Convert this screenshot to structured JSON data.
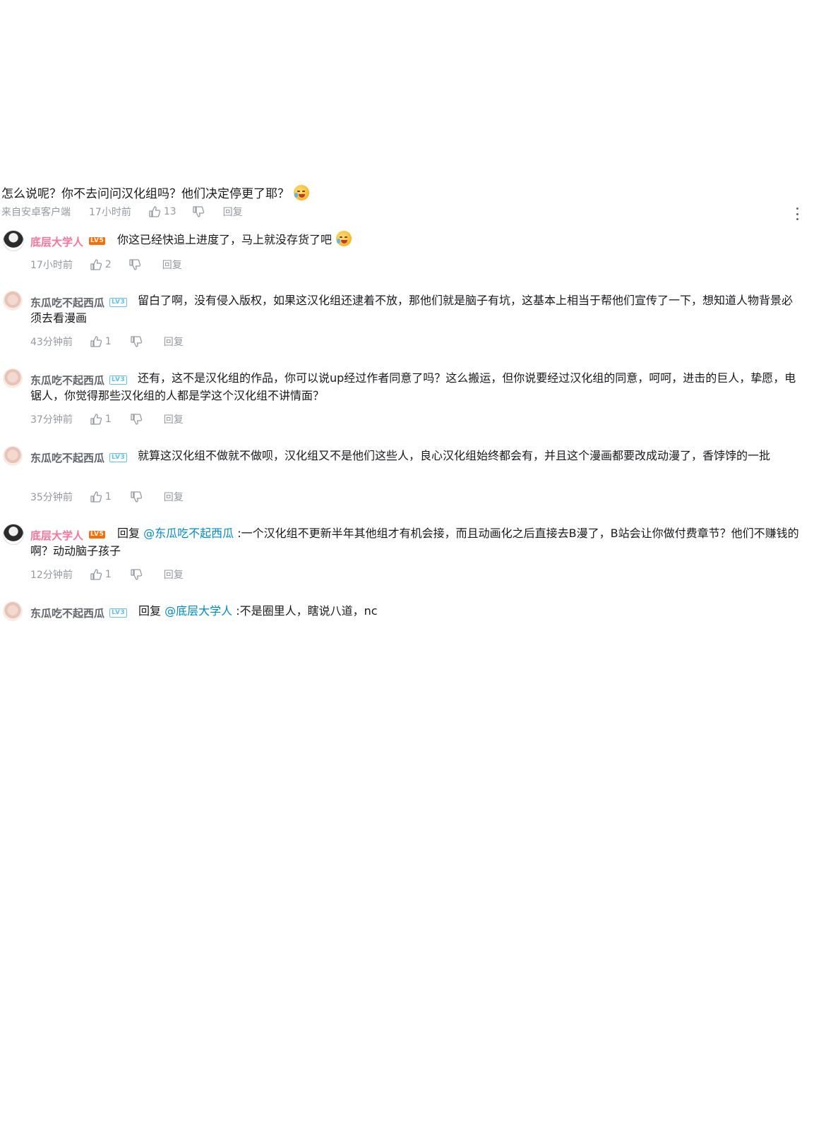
{
  "root_comment": {
    "text": "怎么说呢？你不去问问汉化组吗？他们决定停更了耶？",
    "emoji": "cry-laugh-emoji",
    "source": "来自安卓客户端",
    "time": "17小时前",
    "likes": "13",
    "reply_label": "回复"
  },
  "replies": [
    {
      "user": "底层大学人",
      "level": "LV5",
      "reply_prefix": "",
      "mention": "",
      "text": "你这已经快追上进度了，马上就没存货了吧",
      "has_emoji": true,
      "time": "17小时前",
      "likes": "2",
      "reply_label": "回复"
    },
    {
      "user": "东瓜吃不起西瓜",
      "level": "LV3",
      "reply_prefix": "",
      "mention": "",
      "text": "留白了啊，没有侵入版权，如果这汉化组还逮着不放，那他们就是脑子有坑，这基本上相当于帮他们宣传了一下，想知道人物背景必须去看漫画",
      "time": "43分钟前",
      "likes": "1",
      "reply_label": "回复"
    },
    {
      "user": "东瓜吃不起西瓜",
      "level": "LV3",
      "reply_prefix": "",
      "mention": "",
      "text": "还有，这不是汉化组的作品，你可以说up经过作者同意了吗？这么搬运，但你说要经过汉化组的同意，呵呵，进击的巨人，挚愿，电锯人，你觉得那些汉化组的人都是学这个汉化组不讲情面？",
      "time": "37分钟前",
      "likes": "1",
      "reply_label": "回复"
    },
    {
      "user": "东瓜吃不起西瓜",
      "level": "LV3",
      "reply_prefix": "",
      "mention": "",
      "text": "就算这汉化组不做就不做呗，汉化组又不是他们这些人，良心汉化组始终都会有，并且这个漫画都要改成动漫了，香饽饽的一批",
      "time": "35分钟前",
      "likes": "1",
      "reply_label": "回复"
    },
    {
      "user": "底层大学人",
      "level": "LV5",
      "reply_prefix": "回复",
      "mention": "@东瓜吃不起西瓜",
      "text": ":一个汉化组不更新半年其他组才有机会接，而且动画化之后直接去B漫了，B站会让你做付费章节？他们不赚钱的啊？动动脑子孩子",
      "time": "12分钟前",
      "likes": "1",
      "reply_label": "回复"
    },
    {
      "user": "东瓜吃不起西瓜",
      "level": "LV3",
      "reply_prefix": "回复",
      "mention": "@底层大学人",
      "text": ":不是圈里人，瞎说八道，nc"
    }
  ]
}
